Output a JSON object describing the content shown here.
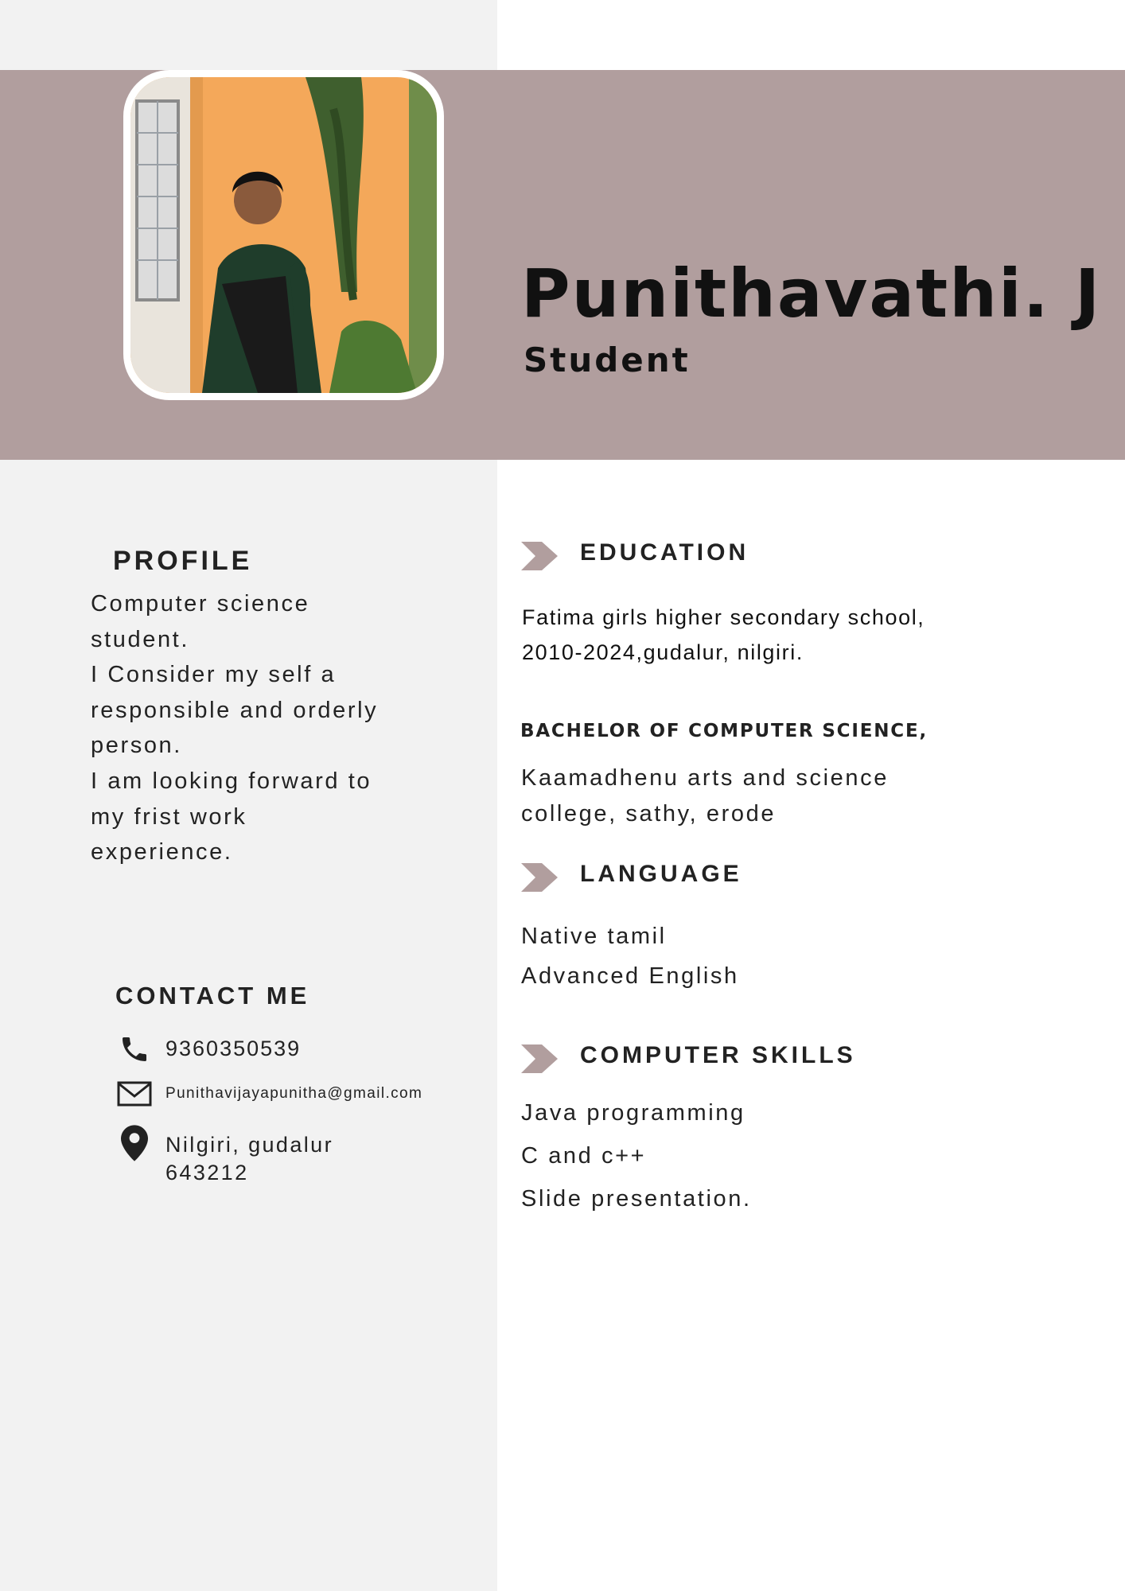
{
  "header": {
    "name": "Punithavathi. J",
    "role": "Student"
  },
  "colors": {
    "banner": "#b19e9e",
    "left_panel": "#f2f2f2",
    "chevron": "#b19e9e",
    "text": "#222222"
  },
  "profile": {
    "heading": "PROFILE",
    "lines": [
      "Computer science",
      "student.",
      "I Consider my self a",
      "responsible and orderly",
      "person.",
      "I am looking forward to",
      "my frist work",
      "experience."
    ]
  },
  "contact": {
    "heading": "CONTACT ME",
    "phone": "9360350539",
    "email": "Punithavijayapunitha@gmail.com",
    "address_line1": "Nilgiri, gudalur",
    "address_line2": "643212",
    "icons": [
      "phone-icon",
      "mail-icon",
      "location-pin-icon"
    ]
  },
  "education": {
    "heading": "EDUCATION",
    "school_line1": "Fatima girls higher secondary school,",
    "school_line2": "2010-2024,gudalur, nilgiri.",
    "degree": "BACHELOR OF COMPUTER SCIENCE,",
    "college_line1": "Kaamadhenu arts and science",
    "college_line2": "college, sathy, erode"
  },
  "language": {
    "heading": "LANGUAGE",
    "items": [
      "Native tamil",
      "Advanced English"
    ]
  },
  "skills": {
    "heading": "COMPUTER SKILLS",
    "items": [
      "Java programming",
      "C and c++",
      "Slide presentation."
    ]
  }
}
